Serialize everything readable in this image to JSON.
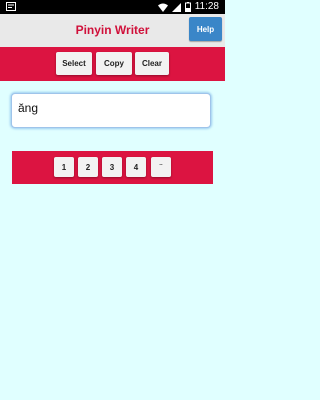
{
  "status_bar": {
    "time": "11:28",
    "icons": [
      "app-notification-icon",
      "wifi-icon",
      "signal-icon",
      "battery-icon"
    ]
  },
  "header": {
    "title": "Pinyin Writer",
    "help_label": "Help"
  },
  "toolbar": {
    "select_label": "Select",
    "copy_label": "Copy",
    "clear_label": "Clear"
  },
  "editor": {
    "value": "ăng"
  },
  "tone_buttons": [
    "1",
    "2",
    "3",
    "4",
    "¨"
  ],
  "colors": {
    "accent": "#DC1441",
    "title": "#D0103A",
    "help": "#3A86C8",
    "background": "#E0FFFF"
  }
}
